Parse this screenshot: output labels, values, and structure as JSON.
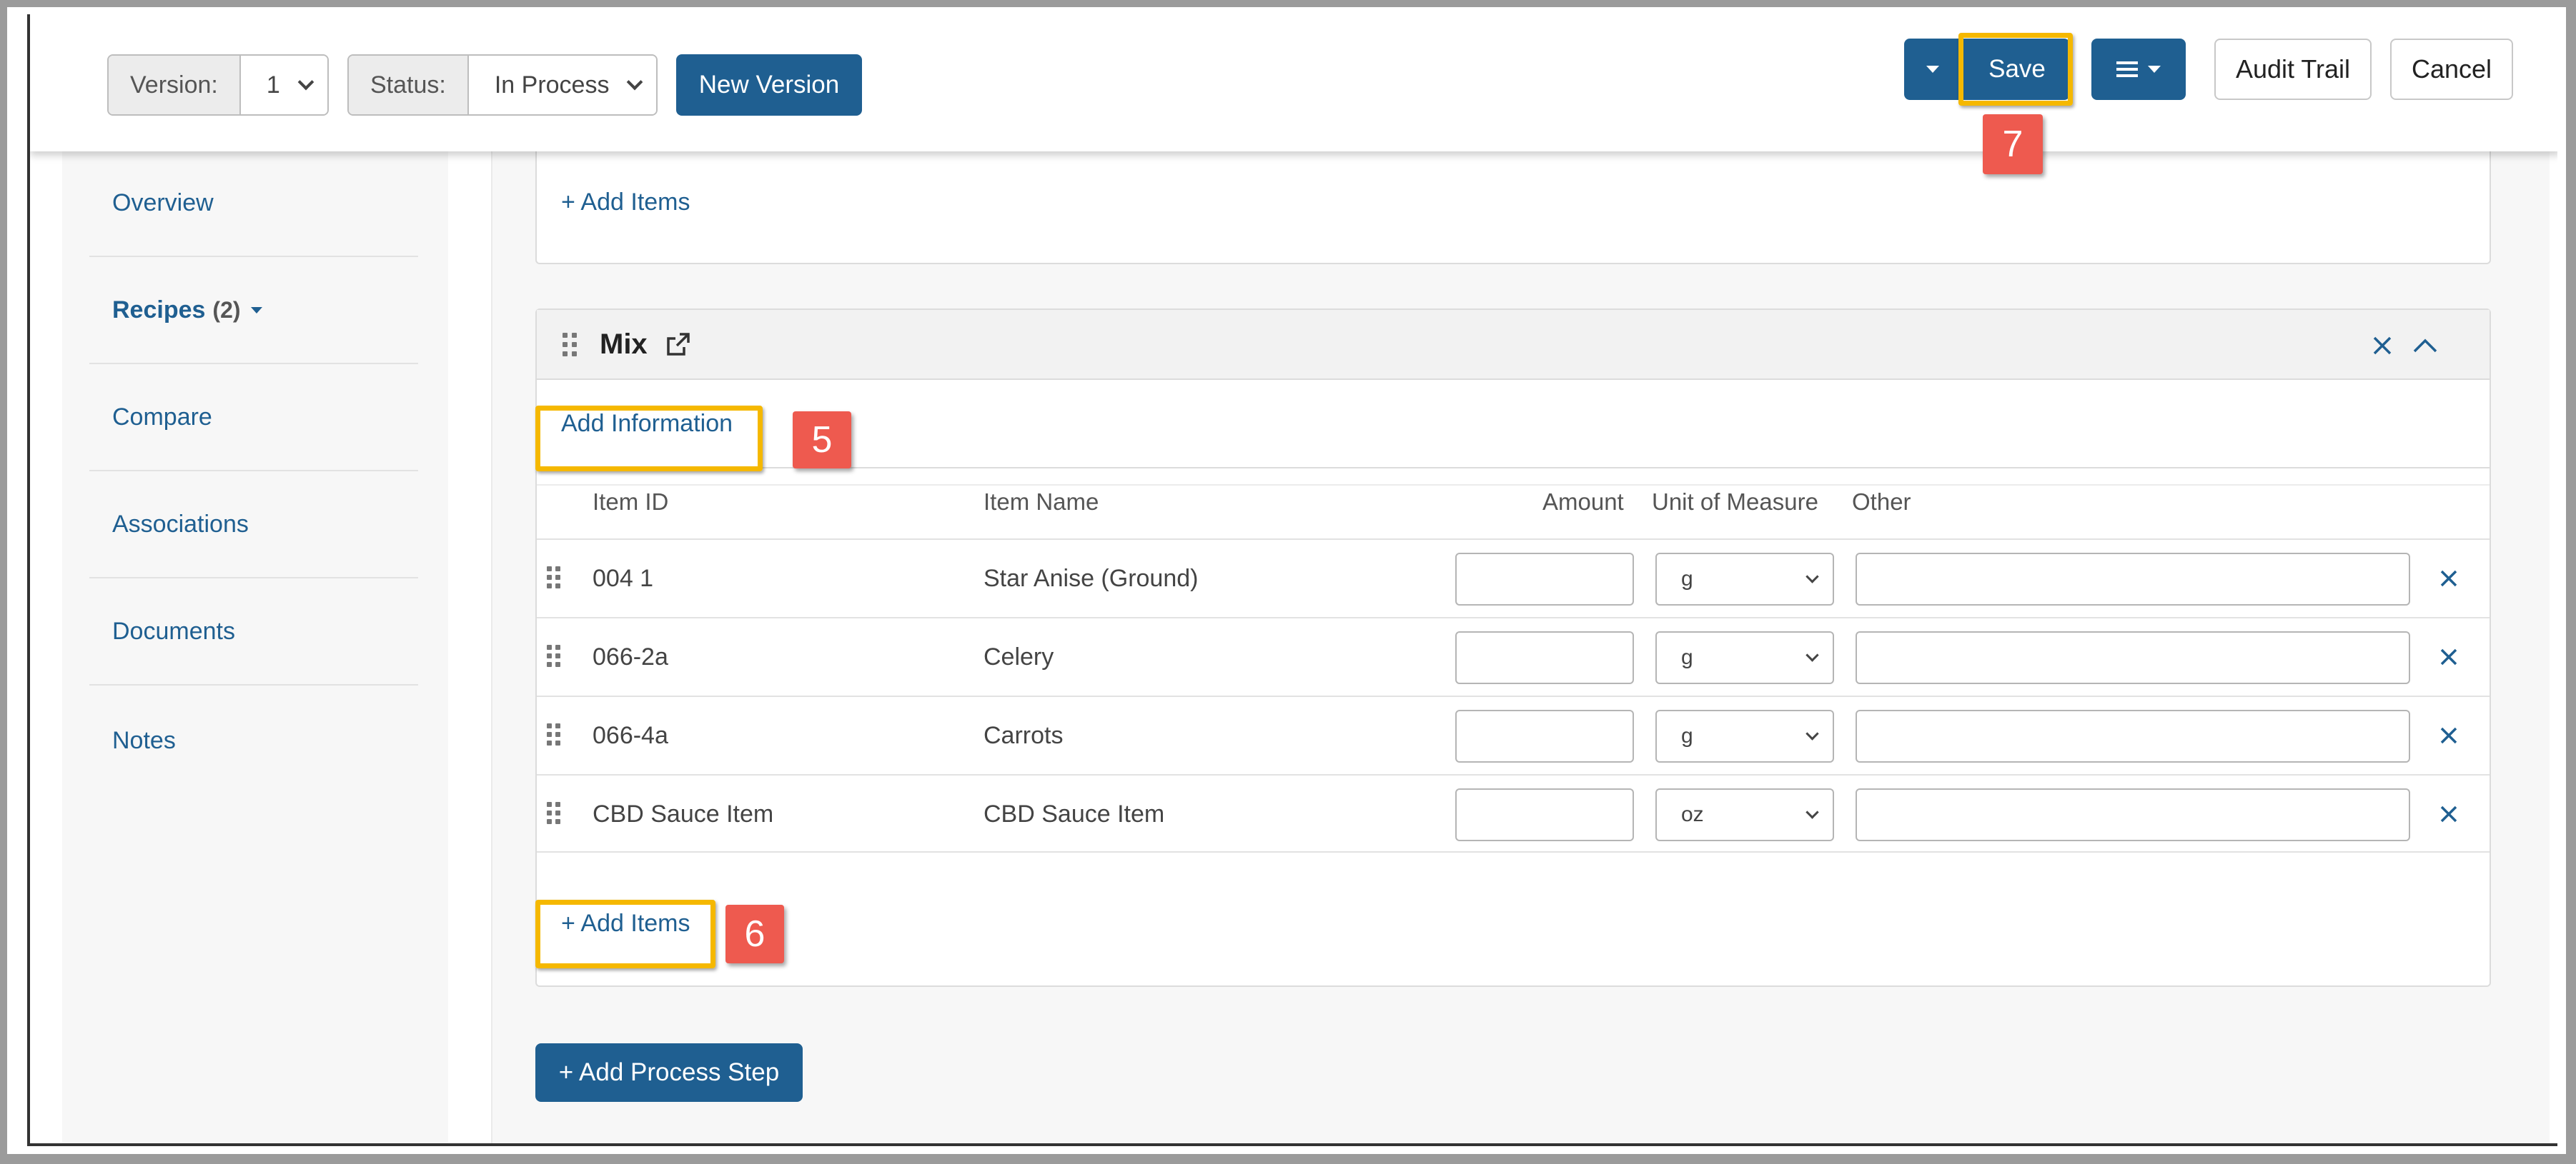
{
  "toolbar": {
    "version_label": "Version:",
    "version_value": "1",
    "status_label": "Status:",
    "status_value": "In Process",
    "new_version": "New Version",
    "save": "Save",
    "audit_trail": "Audit Trail",
    "cancel": "Cancel"
  },
  "sidebar": {
    "items": [
      {
        "label": "Overview"
      },
      {
        "label": "Recipes",
        "count": "(2)"
      },
      {
        "label": "Compare"
      },
      {
        "label": "Associations"
      },
      {
        "label": "Documents"
      },
      {
        "label": "Notes"
      }
    ]
  },
  "top_card": {
    "add_items": "+ Add Items"
  },
  "mix_card": {
    "title": "Mix",
    "add_information": "Add Information",
    "columns": {
      "item_id": "Item ID",
      "item_name": "Item Name",
      "amount": "Amount",
      "uom": "Unit of Measure",
      "other": "Other"
    },
    "rows": [
      {
        "item_id": "004 1",
        "item_name": "Star Anise (Ground)",
        "amount": "",
        "uom": "g",
        "other": ""
      },
      {
        "item_id": "066-2a",
        "item_name": "Celery",
        "amount": "",
        "uom": "g",
        "other": ""
      },
      {
        "item_id": "066-4a",
        "item_name": "Carrots",
        "amount": "",
        "uom": "g",
        "other": ""
      },
      {
        "item_id": "CBD Sauce Item",
        "item_name": "CBD Sauce Item",
        "amount": "",
        "uom": "oz",
        "other": ""
      }
    ],
    "add_items": "+ Add Items"
  },
  "add_process_step": "+ Add Process Step",
  "annotations": {
    "badge_5": "5",
    "badge_6": "6",
    "badge_7": "7"
  },
  "colors": {
    "primary": "#1f5f91",
    "highlight": "#f5b800",
    "badge": "#ee5a4f"
  }
}
